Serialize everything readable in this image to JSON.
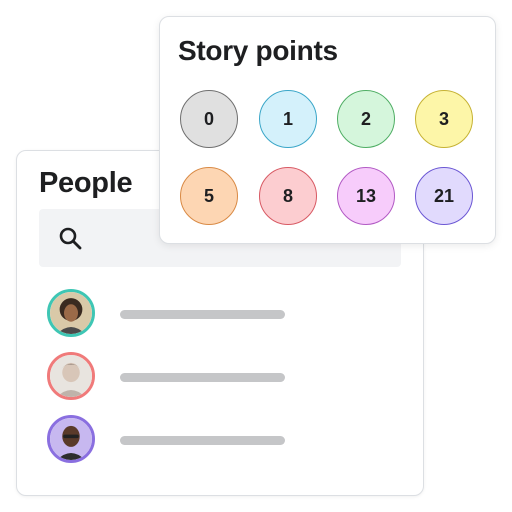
{
  "people": {
    "title": "People",
    "search_icon": "search-icon",
    "persons": [
      {
        "ring_color": "#3ec6b4"
      },
      {
        "ring_color": "#f07a7a"
      },
      {
        "ring_color": "#8a6fe0"
      }
    ]
  },
  "story_points": {
    "title": "Story points",
    "options": [
      {
        "label": "0",
        "fill": "#e0e0e0",
        "border": "#6f6f6f"
      },
      {
        "label": "1",
        "fill": "#d4f1fb",
        "border": "#3aa6c8"
      },
      {
        "label": "2",
        "fill": "#d5f6dc",
        "border": "#4fae64"
      },
      {
        "label": "3",
        "fill": "#fdf6a8",
        "border": "#c6b233"
      },
      {
        "label": "5",
        "fill": "#fdd6b3",
        "border": "#d98a45"
      },
      {
        "label": "8",
        "fill": "#fccdd0",
        "border": "#d85a64"
      },
      {
        "label": "13",
        "fill": "#f7ccfb",
        "border": "#b25ac4"
      },
      {
        "label": "21",
        "fill": "#e1dafd",
        "border": "#6b57d4"
      }
    ]
  }
}
